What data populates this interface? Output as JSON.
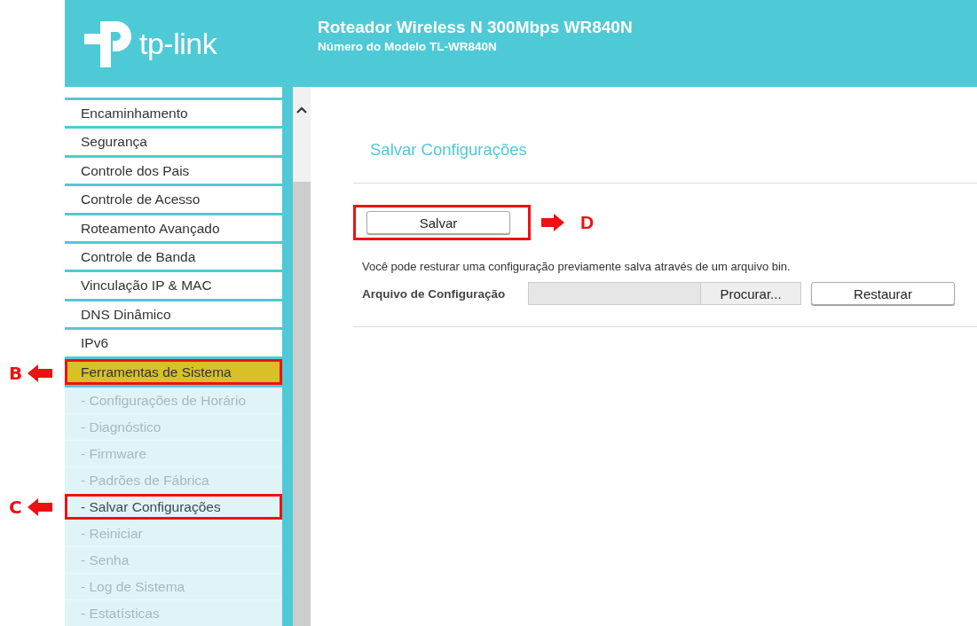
{
  "header": {
    "logo": "tp-link",
    "title": "Roteador Wireless N 300Mbps WR840N",
    "subtitle": "Número do Modelo TL-WR840N"
  },
  "sidebar": {
    "items": [
      {
        "label": "Encaminhamento",
        "selected": false
      },
      {
        "label": "Segurança",
        "selected": false
      },
      {
        "label": "Controle dos Pais",
        "selected": false
      },
      {
        "label": "Controle de Acesso",
        "selected": false
      },
      {
        "label": "Roteamento Avançado",
        "selected": false
      },
      {
        "label": "Controle de Banda",
        "selected": false
      },
      {
        "label": "Vinculação IP & MAC",
        "selected": false
      },
      {
        "label": "DNS Dinâmico",
        "selected": false
      },
      {
        "label": "IPv6",
        "selected": false
      },
      {
        "label": "Ferramentas de Sistema",
        "selected": true,
        "annotation": "B",
        "children": [
          {
            "label": "- Configurações de Horário",
            "selected": false
          },
          {
            "label": "- Diagnóstico",
            "selected": false
          },
          {
            "label": "- Firmware",
            "selected": false
          },
          {
            "label": "- Padrões de Fábrica",
            "selected": false
          },
          {
            "label": "- Salvar Configurações",
            "selected": true,
            "annotation": "C"
          },
          {
            "label": "- Reiniciar",
            "selected": false
          },
          {
            "label": "- Senha",
            "selected": false
          },
          {
            "label": "- Log de Sistema",
            "selected": false
          },
          {
            "label": "- Estatísticas",
            "selected": false
          }
        ]
      }
    ]
  },
  "content": {
    "title": "Salvar Configurações",
    "save_button": {
      "label": "Salvar",
      "annotation": "D"
    },
    "description": "Você pode resturar uma configuração previamente salva através de um arquivo bin.",
    "file_label": "Arquivo de Configuração",
    "browse_button": "Procurar...",
    "restore_button": "Restaurar"
  }
}
